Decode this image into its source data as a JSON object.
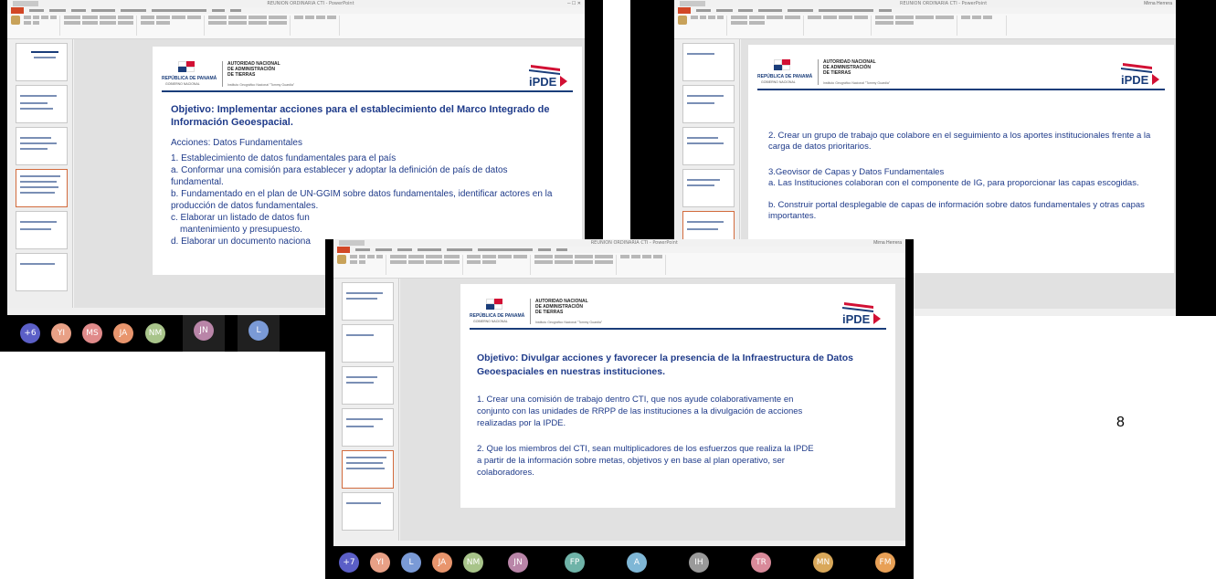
{
  "page_number": "8",
  "powerpoint": {
    "document_title": "REUNION ORDINARIA CTI - PowerPoint",
    "user": "Mirna Herrera"
  },
  "colors": {
    "slide_title": "#1f3b8a",
    "file_tab": "#d24726",
    "panama_red": "#d21034",
    "panama_blue": "#1a3d7a"
  },
  "shot_1": {
    "header": {
      "republic": "REPÚBLICA DE PANAMÁ",
      "government": "GOBIERNO NACIONAL",
      "authority": "AUTORIDAD NACIONAL\nDE ADMINISTRACIÓN\nDE TIERRAS",
      "institute": "Instituto Geográfico Nacional \"Tommy Guardia\""
    },
    "objective": "Objetivo: Implementar acciones para el establecimiento del Marco Integrado de Información Geoespacial.",
    "section": "Acciones: Datos Fundamentales",
    "items": [
      "1. Establecimiento de datos fundamentales para el país",
      "a. Conformar una comisión para establecer y adoptar la definición de país de datos fundamental.",
      "b. Fundamentado en el plan de UN-GGIM sobre datos fundamentales, identificar actores en la producción de datos fundamentales.",
      "c. Elaborar un listado de datos fun",
      "mantenimiento y presupuesto.",
      "d. Elaborar un documento naciona"
    ],
    "participants": [
      {
        "initials": "+6",
        "color": "#5b5fc7"
      },
      {
        "initials": "YI",
        "color": "#e8a086"
      },
      {
        "initials": "MS",
        "color": "#e08a8a"
      },
      {
        "initials": "JA",
        "color": "#e8956d"
      },
      {
        "initials": "NM",
        "color": "#a8c48a"
      },
      {
        "initials": "JN",
        "color": "#b985a8"
      },
      {
        "initials": "L",
        "color": "#7a9ad6"
      }
    ]
  },
  "shot_2": {
    "paragraphs": [
      "2. Crear un grupo de trabajo que colabore en el seguimiento a  los aportes institucionales frente a la carga de datos prioritarios.",
      "3.Geovisor de Capas y Datos Fundamentales",
      "a. Las Instituciones colaboran con el componente de IG, para proporcionar las capas escogidas.",
      "b. Construir portal desplegable de capas de información sobre datos fundamentales y otras capas importantes."
    ],
    "participants": [
      {
        "initials": "A",
        "color": "#7fb7d6"
      },
      {
        "initials": "IH",
        "color": "#9a9a9a"
      },
      {
        "initials": "TR",
        "color": "#d98a9a"
      },
      {
        "initials": "MN",
        "color": "#d9a85a"
      },
      {
        "initials": "FM",
        "color": "#e8a056"
      }
    ]
  },
  "shot_3": {
    "objective": "Objetivo: Divulgar acciones y favorecer la presencia de la Infraestructura de Datos Geoespaciales en nuestras instituciones.",
    "items": [
      "1. Crear una comisión de trabajo dentro CTI, que nos ayude colaborativamente en conjunto con las unidades de RRPP de las instituciones a la divulgación de acciones realizadas por la IPDE.",
      "2. Que los miembros del CTI, sean multiplicadores de los esfuerzos que realiza la IPDE a partir de la información sobre metas, objetivos y en base al plan operativo, ser colaboradores."
    ],
    "participants": [
      {
        "initials": "+7",
        "color": "#5b5fc7"
      },
      {
        "initials": "YI",
        "color": "#e8a086"
      },
      {
        "initials": "L",
        "color": "#7a9ad6"
      },
      {
        "initials": "JA",
        "color": "#e8956d"
      },
      {
        "initials": "NM",
        "color": "#a8c48a"
      },
      {
        "initials": "JN",
        "color": "#b985a8"
      },
      {
        "initials": "FP",
        "color": "#6fb3a8"
      },
      {
        "initials": "A",
        "color": "#7fb7d6"
      },
      {
        "initials": "IH",
        "color": "#9a9a9a"
      },
      {
        "initials": "TR",
        "color": "#d98a9a"
      },
      {
        "initials": "MN",
        "color": "#d9a85a"
      },
      {
        "initials": "FM",
        "color": "#e8a056"
      }
    ]
  }
}
